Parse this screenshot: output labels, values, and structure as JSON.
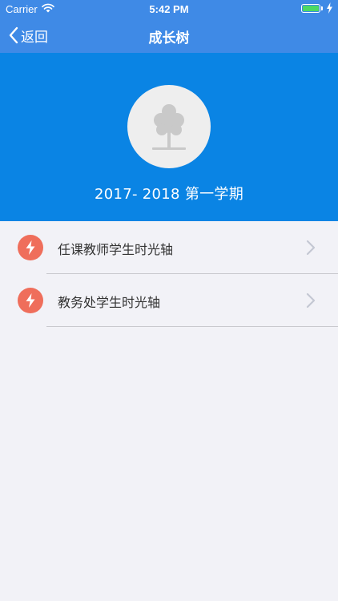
{
  "status_bar": {
    "carrier": "Carrier",
    "time": "5:42 PM",
    "battery_level": 1.0,
    "icons": [
      "wifi-icon",
      "battery-icon",
      "charging-icon"
    ]
  },
  "nav_bar": {
    "back_label": "返回",
    "title": "成长树"
  },
  "header": {
    "avatar_icon": "tree-icon",
    "term": "2017- 2018  第一学期"
  },
  "menu": {
    "items": [
      {
        "label": "任课教师学生时光轴",
        "icon": "lightning-icon"
      },
      {
        "label": "教务处学生时光轴",
        "icon": "lightning-icon"
      }
    ]
  },
  "colors": {
    "nav_bar": "#3f8ae6",
    "header": "#0a84e4",
    "badge": "#ef6e5b",
    "background": "#f2f2f7"
  }
}
